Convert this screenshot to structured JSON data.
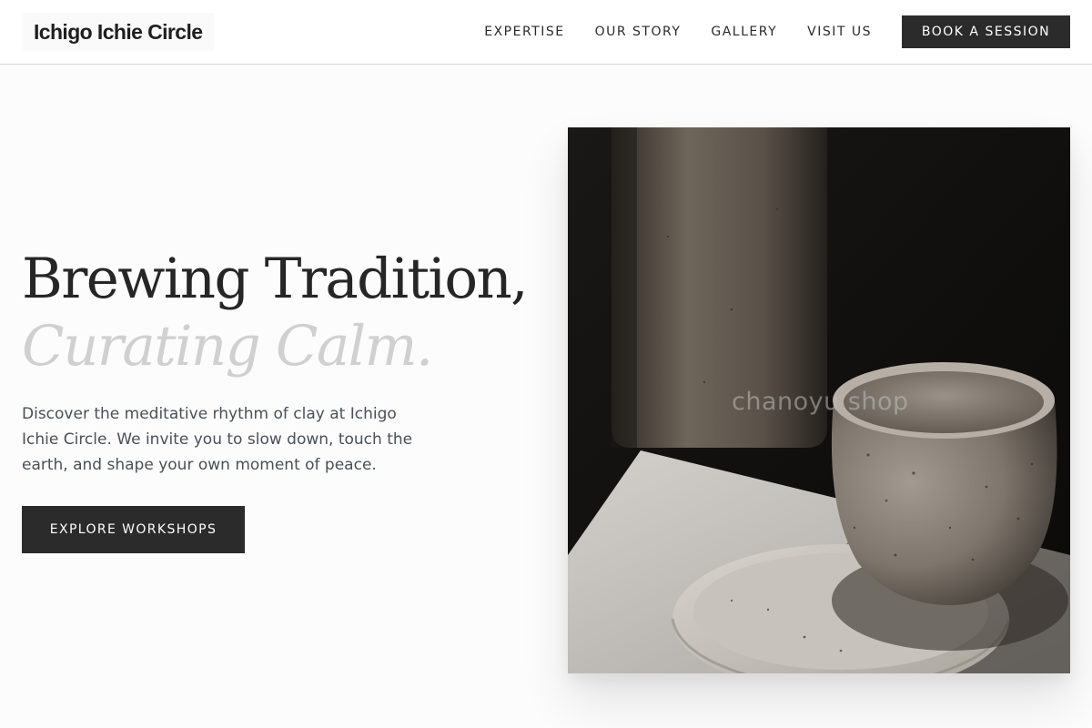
{
  "header": {
    "logo": "Ichigo Ichie Circle",
    "nav": [
      "EXPERTISE",
      "OUR STORY",
      "GALLERY",
      "VISIT US"
    ],
    "cta": "BOOK A SESSION"
  },
  "hero": {
    "title_line1": "Brewing Tradition,",
    "title_line2": "Curating Calm.",
    "description": "Discover the meditative rhythm of clay at Ichigo Ichie Circle. We invite you to slow down, touch the earth, and shape your own moment of peace.",
    "cta": "EXPLORE WORKSHOPS",
    "image": {
      "subject": "ceramic-cup-on-saucer-photo",
      "watermark": "chanoyu shop"
    }
  },
  "colors": {
    "page_bg": "#fcfcfc",
    "header_bg": "#ffffff",
    "dark_button": "#2b2b2b",
    "title_text": "#262626",
    "title_accent": "#d0d0d0",
    "body_text": "#4a5059"
  }
}
